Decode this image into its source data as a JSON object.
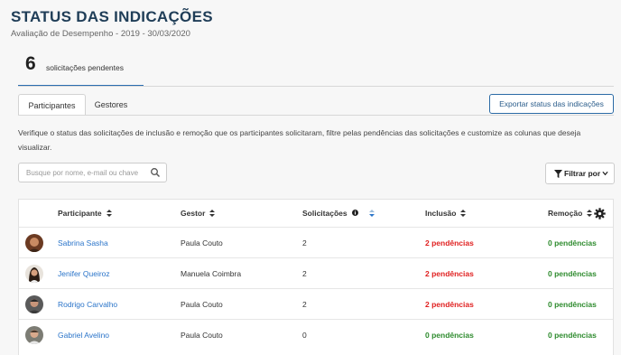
{
  "page": {
    "title": "STATUS DAS INDICAÇÕES",
    "subtitle": "Avaliação de Desempenho - 2019 - 30/03/2020"
  },
  "summary": {
    "count": "6",
    "label": "solicitações pendentes"
  },
  "tabs": [
    {
      "label": "Participantes",
      "active": true
    },
    {
      "label": "Gestores",
      "active": false
    }
  ],
  "export_button": "Exportar status das indicações",
  "description": "Verifique o status das solicitações de inclusão e remoção que os participantes solicitaram, filtre pelas pendências das solicitações e customize as colunas que deseja visualizar.",
  "search": {
    "placeholder": "Busque por nome, e-mail ou chave",
    "icon": "search-icon"
  },
  "filter_button": {
    "label": "Filtrar por",
    "icon": "filter-icon"
  },
  "table": {
    "columns": [
      "Participante",
      "Gestor",
      "Solicitações",
      "Inclusão",
      "Remoção"
    ],
    "rows": [
      {
        "participant": "Sabrina Sasha",
        "manager": "Paula Couto",
        "requests": "2",
        "inclusion": "2 pendências",
        "removal": "0 pendências"
      },
      {
        "participant": "Jenifer Queiroz",
        "manager": "Manuela Coimbra",
        "requests": "2",
        "inclusion": "2 pendências",
        "removal": "0 pendências"
      },
      {
        "participant": "Rodrigo Carvalho",
        "manager": "Paula Couto",
        "requests": "2",
        "inclusion": "2 pendências",
        "removal": "0 pendências"
      },
      {
        "participant": "Gabriel Avelino",
        "manager": "Paula Couto",
        "requests": "0",
        "inclusion": "0 pendências",
        "removal": "0 pendências"
      }
    ]
  },
  "colors": {
    "pending": "#e02020",
    "ok": "#2e8b2e",
    "link": "#2a74c9",
    "title": "#1f3d57"
  }
}
